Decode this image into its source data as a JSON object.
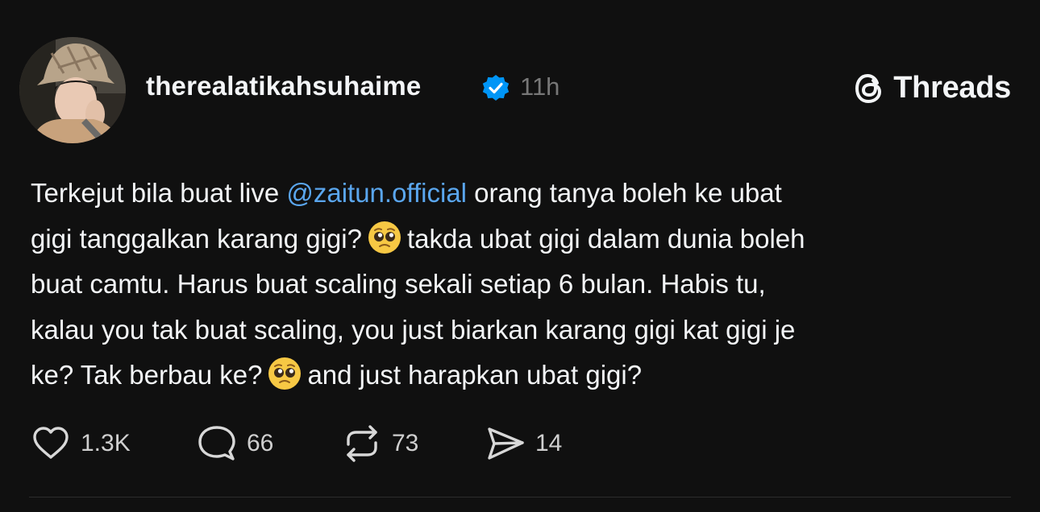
{
  "post": {
    "author": {
      "username": "therealatikahsuhaime",
      "verified": true,
      "avatar_icon": "profile-photo"
    },
    "timestamp": "11h",
    "brand": {
      "name": "Threads",
      "icon": "threads-logo-icon"
    },
    "text": {
      "line1_before": "Terkejut bila buat live ",
      "mention": "@zaitun.official",
      "line1_after": " orang tanya boleh ke ubat",
      "line2_before": "gigi tanggalkan karang gigi?",
      "line2_after": "takda ubat gigi dalam dunia boleh",
      "line3": "buat camtu. Harus buat scaling sekali setiap 6 bulan. Habis tu,",
      "line4": "kalau you tak buat scaling, you just biarkan karang gigi kat gigi je",
      "line5_before": "ke? Tak berbau ke?",
      "line5_after": "and just harapkan ubat gigi?",
      "emoji": "pleading-face"
    },
    "actions": {
      "like_count": "1.3K",
      "reply_count": "66",
      "repost_count": "73",
      "share_count": "14"
    },
    "colors": {
      "background": "#101010",
      "text": "#f3f5f7",
      "mention": "#5aa6ee",
      "verified_badge": "#0095f6",
      "muted": "#777777"
    }
  }
}
